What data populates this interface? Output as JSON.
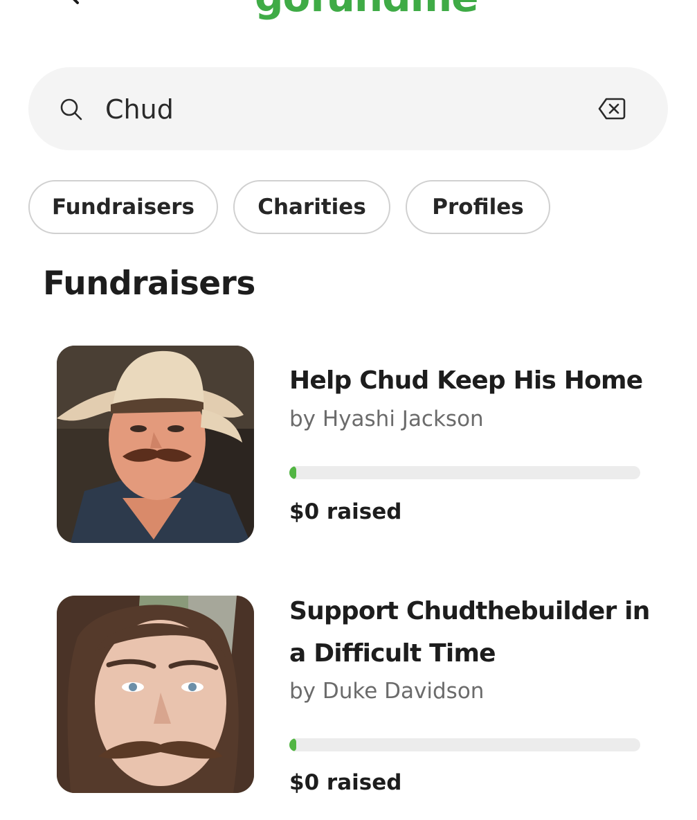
{
  "header": {
    "logo_text": "gofundme",
    "logo_color": "#3fab46",
    "search_icon": "search-icon",
    "menu_icon": "menu-icon"
  },
  "search": {
    "value": "Chud",
    "icon": "search-icon",
    "clear_icon": "clear-input-icon"
  },
  "filters": {
    "fundraisers_label": "Fundraisers",
    "charities_label": "Charities",
    "profiles_label": "Profiles"
  },
  "section": {
    "title": "Fundraisers"
  },
  "fundraisers": [
    {
      "title": "Help Chud Keep His Home",
      "organizer": "by Hyashi Jackson",
      "raised": "$0 raised",
      "progress_percent": 0
    },
    {
      "title": "Support Chudthebuilder in a Difficult Time",
      "organizer": "by Duke Davidson",
      "raised": "$0 raised",
      "progress_percent": 0
    }
  ],
  "colors": {
    "progress_fill": "#52b543",
    "progress_track": "#ececec",
    "search_background": "#f4f4f4"
  }
}
